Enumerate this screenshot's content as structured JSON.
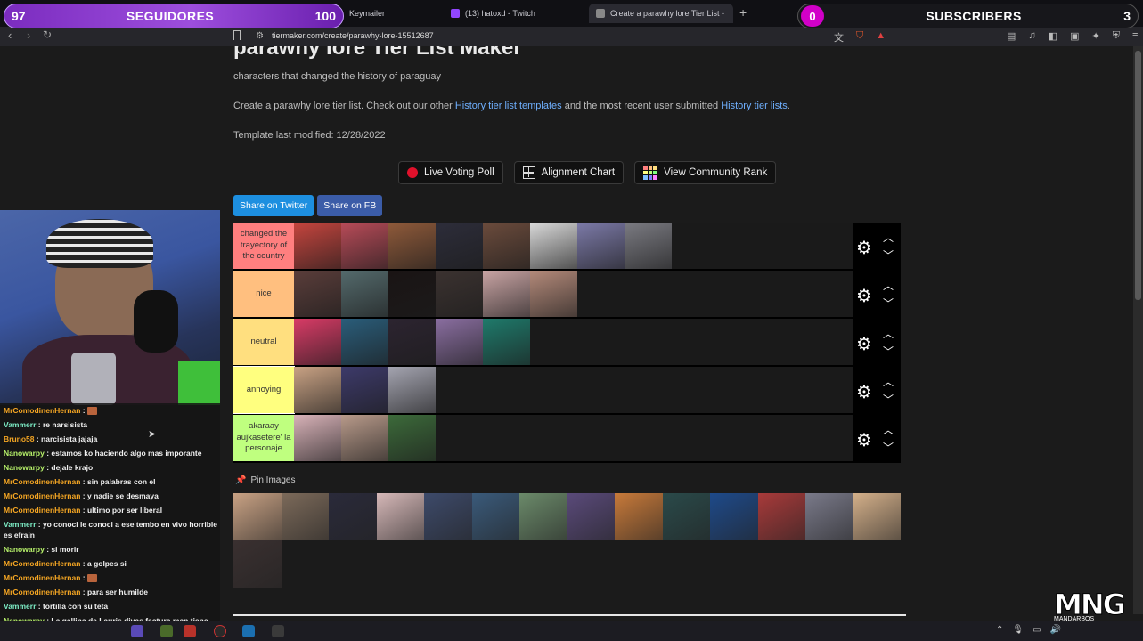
{
  "colors": {
    "tier_s": "#ff7f7f",
    "tier_a": "#ffbf7f",
    "tier_b": "#ffdf7f",
    "tier_c": "#ffff7f",
    "tier_d": "#bfff7f",
    "twitter": "#1d8fe0",
    "facebook": "#3b5ca8",
    "link": "#6fb0ff"
  },
  "browser": {
    "tabs": [
      {
        "label": "Keymailer"
      },
      {
        "label": "(13) hatoxd - Twitch"
      },
      {
        "label": "Create a parawhy lore Tier List -"
      }
    ],
    "url": "tiermaker.com/create/parawhy-lore-15512687"
  },
  "overlay": {
    "followers_count": "97",
    "followers_label": "SEGUIDORES",
    "followers_goal": "100",
    "subs_count": "0",
    "subs_label": "SUBSCRIBERS",
    "subs_goal": "3"
  },
  "page": {
    "title": "parawhy lore Tier List Maker",
    "description": "characters that changed the history of paraguay",
    "create_prefix": "Create a parawhy lore tier list. Check out our other ",
    "create_link1": "History tier list templates",
    "create_mid": " and the most recent user submitted ",
    "create_link2": "History tier lists",
    "create_suffix": ".",
    "last_modified": "Template last modified:  12/28/2022",
    "buttons": {
      "live_voting": "Live Voting Poll",
      "alignment": "Alignment Chart",
      "community_rank": "View Community Rank"
    },
    "share_twitter": "Share on Twitter",
    "share_fb": "Share on FB",
    "pin_images": "Pin Images"
  },
  "tiers": [
    {
      "label": "changed the trayectory of the country",
      "color": "#ff7f7f",
      "items": [
        "#c6453e",
        "#b84b58",
        "#8f5a3a",
        "#2d2d3a",
        "#6b4b3c",
        "#d9d9d9",
        "#7c7aa8",
        "#7b7b82"
      ]
    },
    {
      "label": "nice",
      "color": "#ffbf7f",
      "items": [
        "#5a3d3a",
        "#546a6c",
        "#1a1414",
        "#3b3230",
        "#c9a4a4",
        "#b48a7a"
      ]
    },
    {
      "label": "neutral",
      "color": "#ffdf7f",
      "items": [
        "#d83b66",
        "#2a5d7a",
        "#2c2430",
        "#8a6ea0",
        "#1f7a6b"
      ]
    },
    {
      "label": "annoying",
      "color": "#ffff7f",
      "items": [
        "#c9a284",
        "#3d3a6a",
        "#a4a4b0"
      ]
    },
    {
      "label": "akaraay aujkasetere' la personaje",
      "color": "#bfff7f",
      "items": [
        "#d8b2b8",
        "#b89a8a",
        "#3c6a3a"
      ]
    }
  ],
  "pool_items": [
    "#c9a284",
    "#7c6a5a",
    "#2a2a3a",
    "#d6b8b8",
    "#3d4a6a",
    "#3a5a7a",
    "#6b8a6a",
    "#5a4a7a",
    "#c87a3a",
    "#2a4a4a",
    "#1e4a8a",
    "#a83a3a",
    "#7a7a8a",
    "#d4b08a",
    "#3a3030"
  ],
  "chat": [
    {
      "user": "MrComodinenHernan",
      "color": "#f5a623",
      "text": " : ",
      "emote": true
    },
    {
      "user": "Vammerr",
      "color": "#7ef0c8",
      "text": " : re narsisista"
    },
    {
      "user": "Bruno58",
      "color": "#f5a623",
      "text": " : narcisista jajaja"
    },
    {
      "user": "Nanowarpy",
      "color": "#b6f06a",
      "text": " : estamos ko haciendo algo mas imporante"
    },
    {
      "user": "Nanowarpy",
      "color": "#b6f06a",
      "text": " : dejale krajo"
    },
    {
      "user": "MrComodinenHernan",
      "color": "#f5a623",
      "text": " : sin palabras con el"
    },
    {
      "user": "MrComodinenHernan",
      "color": "#f5a623",
      "text": " : y nadie se desmaya"
    },
    {
      "user": "MrComodinenHernan",
      "color": "#f5a623",
      "text": " : ultimo por ser liberal"
    },
    {
      "user": "Vammerr",
      "color": "#7ef0c8",
      "text": " : yo conoci le conoci a ese tembo en vivo horrible es efrain"
    },
    {
      "user": "Nanowarpy",
      "color": "#b6f06a",
      "text": " : si morir"
    },
    {
      "user": "MrComodinenHernan",
      "color": "#f5a623",
      "text": " : a golpes si"
    },
    {
      "user": "MrComodinenHernan",
      "color": "#f5a623",
      "text": " : ",
      "emote": true
    },
    {
      "user": "MrComodinenHernan",
      "color": "#f5a623",
      "text": " : para ser humilde"
    },
    {
      "user": "Vammerr",
      "color": "#7ef0c8",
      "text": " : tortilla con su teta"
    },
    {
      "user": "Nanowarpy",
      "color": "#b6f06a",
      "text": " : La gallina de Lauris divas factura man tiene contrato con empresas xD"
    }
  ],
  "logo": {
    "main": "MNG",
    "sub": "MANDARBOS"
  }
}
